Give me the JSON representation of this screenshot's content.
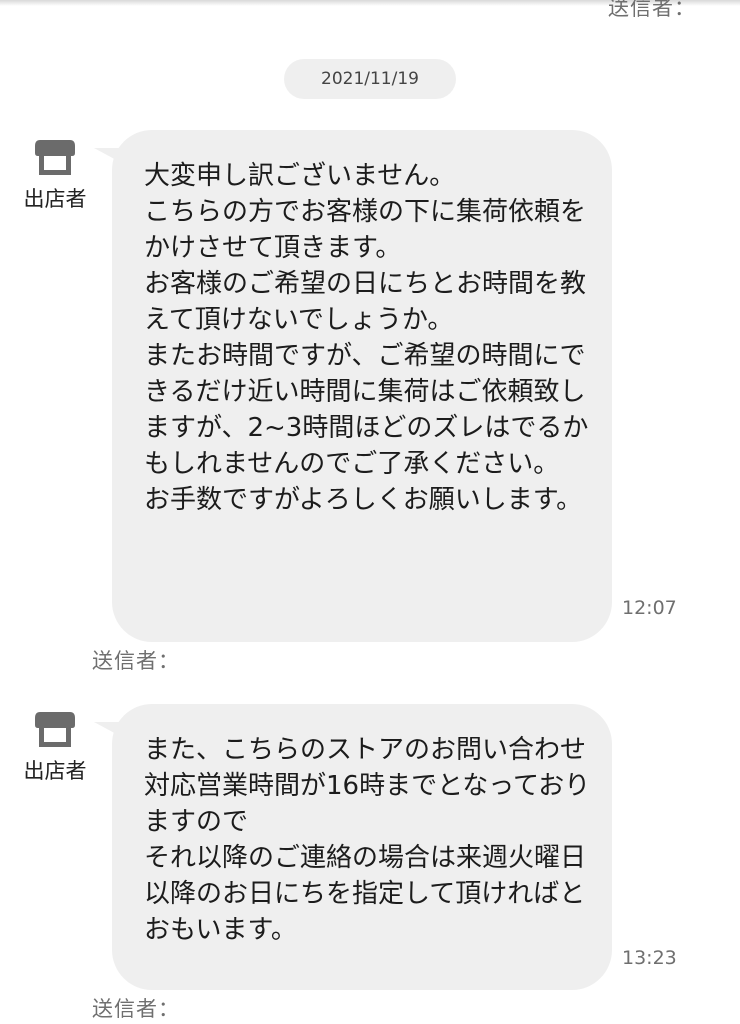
{
  "header": {
    "sender_label_partial": "送信者："
  },
  "date_separator": "2021/11/19",
  "colors": {
    "bubble_background": "#efefef",
    "date_pill_background": "#efefef",
    "secondary_text": "#6f6f6f",
    "store_icon": "#6b6b6b"
  },
  "messages": [
    {
      "avatar_icon": "store-icon",
      "avatar_label": "出店者",
      "text": "大変申し訳ございません。\nこちらの方でお客様の下に集荷依頼をかけさせて頂きます。\nお客様のご希望の日にちとお時間を教えて頂けないでしょうか。\nまたお時間ですが、ご希望の時間にできるだけ近い時間に集荷はご依頼致しますが、2~3時間ほどのズレはでるかもしれませんのでご了承ください。\nお手数ですがよろしくお願いします。",
      "time": "12:07",
      "sender_label": "送信者："
    },
    {
      "avatar_icon": "store-icon",
      "avatar_label": "出店者",
      "text": "また、こちらのストアのお問い合わせ対応営業時間が16時までとなっておりますので\nそれ以降のご連絡の場合は来週火曜日以降のお日にちを指定して頂ければとおもいます。",
      "time": "13:23",
      "sender_label": "送信者："
    }
  ]
}
